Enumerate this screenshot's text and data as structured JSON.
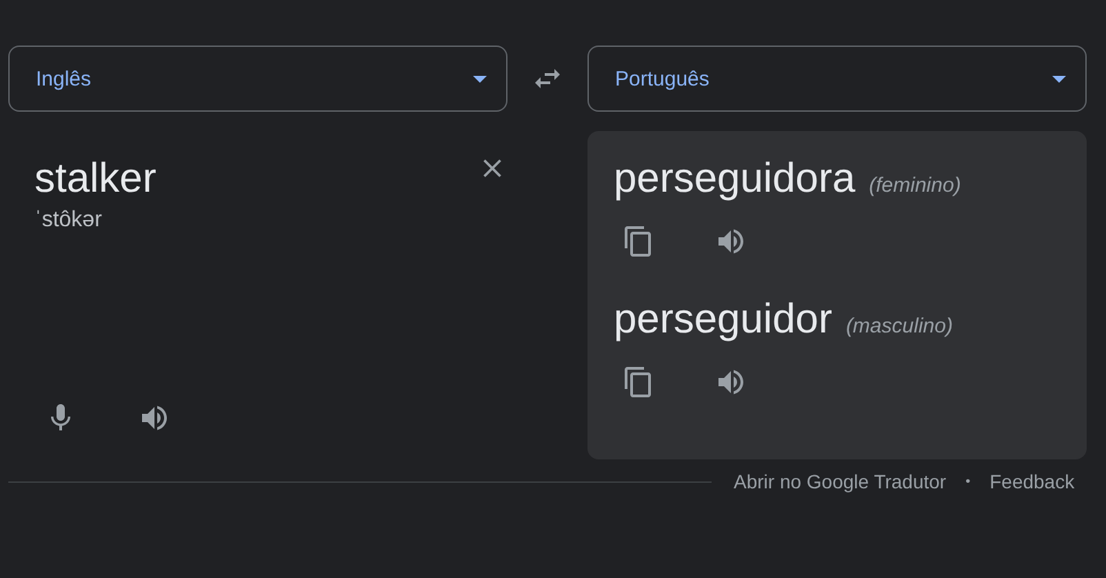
{
  "source_language": {
    "label": "Inglês"
  },
  "target_language": {
    "label": "Português"
  },
  "source": {
    "text": "stalker",
    "pronunciation": "ˈstôkər"
  },
  "translations": [
    {
      "text": "perseguidora",
      "gender": "(feminino)"
    },
    {
      "text": "perseguidor",
      "gender": "(masculino)"
    }
  ],
  "footer": {
    "link": "Abrir no Google Tradutor",
    "separator": "•",
    "feedback": "Feedback"
  }
}
